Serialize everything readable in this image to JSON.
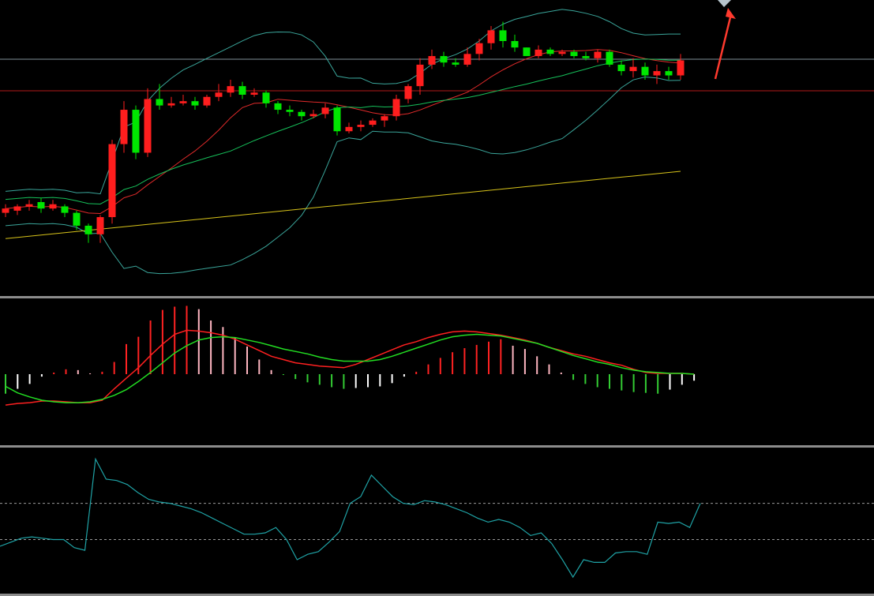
{
  "colors": {
    "background": "#000000",
    "candle_up": "#ff1e1e",
    "candle_down": "#00e600",
    "pane_divider": "#8c8c8c",
    "boll_band": "#3aa59a",
    "ma_mid": "#e02a2a",
    "ma_long": "#16c05a",
    "ma_yellow": "#d6c21a",
    "h_line_gray": "#7f8f99",
    "h_line_red": "#b31a1a",
    "macd_pos": "#ff2222",
    "macd_pos_fade": "#ffb6c1",
    "macd_neg": "#33cc33",
    "macd_neg_fade": "#ffffff",
    "dif_line": "#ff2020",
    "dea_line": "#22dd22",
    "osc_line": "#1fa3a6",
    "osc_level": "#9a9a9a",
    "arrow": "#ff3a2e",
    "marker": "#b7c4cc"
  },
  "chart_data": [
    {
      "type": "candlestick",
      "pane": "price",
      "x_count": 58,
      "ylim": [
        0,
        100
      ],
      "candles": [
        [
          20,
          22,
          18,
          24
        ],
        [
          21,
          23,
          19,
          24
        ],
        [
          23,
          24,
          21,
          26
        ],
        [
          25,
          22,
          20,
          27
        ],
        [
          22,
          24,
          21,
          26
        ],
        [
          23,
          20,
          18,
          24
        ],
        [
          20,
          14,
          12,
          21
        ],
        [
          14,
          10,
          6,
          15
        ],
        [
          10,
          18,
          6,
          19
        ],
        [
          18,
          52,
          15,
          54
        ],
        [
          52,
          68,
          48,
          72
        ],
        [
          68,
          48,
          45,
          70
        ],
        [
          48,
          73,
          46,
          78
        ],
        [
          73,
          70,
          68,
          80
        ],
        [
          70,
          71,
          69,
          74
        ],
        [
          71,
          72,
          70,
          75
        ],
        [
          72,
          70,
          68,
          74
        ],
        [
          70,
          74,
          69,
          75
        ],
        [
          74,
          76,
          72,
          80
        ],
        [
          76,
          79,
          74,
          82
        ],
        [
          79,
          75,
          73,
          81
        ],
        [
          75,
          76,
          74,
          78
        ],
        [
          76,
          71,
          69,
          77
        ],
        [
          71,
          68,
          66,
          72
        ],
        [
          68,
          67,
          65,
          70
        ],
        [
          67,
          65,
          63,
          68
        ],
        [
          65,
          66,
          64,
          68
        ],
        [
          66,
          69,
          64,
          71
        ],
        [
          69,
          58,
          56,
          70
        ],
        [
          58,
          60,
          57,
          62
        ],
        [
          60,
          61,
          58,
          63
        ],
        [
          61,
          63,
          60,
          64
        ],
        [
          63,
          65,
          60,
          66
        ],
        [
          65,
          73,
          63,
          75
        ],
        [
          73,
          79,
          71,
          80
        ],
        [
          79,
          89,
          75,
          92
        ],
        [
          89,
          93,
          87,
          96
        ],
        [
          93,
          90,
          88,
          95
        ],
        [
          90,
          89,
          88,
          92
        ],
        [
          89,
          94,
          88,
          97
        ],
        [
          94,
          99,
          91,
          101
        ],
        [
          99,
          105,
          96,
          107
        ],
        [
          105,
          100,
          97,
          109
        ],
        [
          100,
          97,
          95,
          103
        ],
        [
          97,
          93,
          94,
          97
        ],
        [
          93,
          96,
          92,
          98
        ],
        [
          96,
          94,
          93,
          97
        ],
        [
          94,
          95,
          93,
          96
        ],
        [
          95,
          93,
          92,
          96
        ],
        [
          93,
          92,
          91,
          95
        ],
        [
          92,
          95,
          90,
          96
        ],
        [
          95,
          89,
          88,
          96
        ],
        [
          89,
          86,
          84,
          91
        ],
        [
          86,
          88,
          83,
          92
        ],
        [
          88,
          84,
          82,
          90
        ],
        [
          84,
          86,
          80,
          89
        ],
        [
          86,
          84,
          82,
          88
        ],
        [
          84,
          91,
          82,
          94
        ]
      ]
    },
    {
      "type": "histogram",
      "pane": "macd",
      "values": [
        -2.4,
        -1.8,
        -1.2,
        -0.3,
        0.2,
        0.6,
        0.5,
        0.1,
        0.3,
        1.5,
        3.7,
        4.6,
        6.6,
        7.9,
        8.3,
        8.4,
        8.0,
        6.6,
        5.8,
        4.5,
        3.4,
        1.8,
        0.5,
        -0.1,
        -0.6,
        -1.0,
        -1.3,
        -1.6,
        -1.8,
        -1.7,
        -1.6,
        -1.5,
        -1.1,
        -0.3,
        0.3,
        1.2,
        2.0,
        2.7,
        3.2,
        3.6,
        4.0,
        4.3,
        3.5,
        3.1,
        2.2,
        1.2,
        0.2,
        -0.7,
        -1.2,
        -1.6,
        -1.8,
        -2.0,
        -2.2,
        -2.3,
        -2.4,
        -1.9,
        -1.3,
        -0.8
      ],
      "dif": [
        -3.8,
        -3.6,
        -3.5,
        -3.3,
        -3.3,
        -3.4,
        -3.5,
        -3.5,
        -3.2,
        -1.8,
        -0.5,
        0.8,
        2.3,
        3.7,
        4.9,
        5.4,
        5.3,
        5.1,
        4.8,
        4.3,
        3.6,
        2.9,
        2.2,
        1.8,
        1.4,
        1.2,
        1.0,
        0.9,
        0.8,
        1.2,
        1.8,
        2.4,
        3.0,
        3.6,
        4.0,
        4.5,
        4.9,
        5.2,
        5.3,
        5.2,
        5.0,
        4.8,
        4.5,
        4.2,
        3.8,
        3.3,
        2.9,
        2.5,
        2.2,
        1.8,
        1.4,
        1.1,
        0.6,
        0.2,
        0.1,
        0.1,
        0.1,
        0.0
      ],
      "dea": [
        -1.5,
        -2.3,
        -2.8,
        -3.2,
        -3.4,
        -3.5,
        -3.5,
        -3.4,
        -3.1,
        -2.6,
        -1.9,
        -0.9,
        0.2,
        1.4,
        2.6,
        3.5,
        4.2,
        4.5,
        4.6,
        4.5,
        4.2,
        3.9,
        3.5,
        3.1,
        2.8,
        2.5,
        2.1,
        1.8,
        1.6,
        1.6,
        1.6,
        1.8,
        2.2,
        2.7,
        3.2,
        3.7,
        4.2,
        4.6,
        4.8,
        4.9,
        4.8,
        4.7,
        4.4,
        4.1,
        3.8,
        3.3,
        2.8,
        2.3,
        1.9,
        1.5,
        1.2,
        0.8,
        0.5,
        0.3,
        0.2,
        0.1,
        0.1,
        0.0
      ]
    },
    {
      "type": "line",
      "pane": "oscillator",
      "values": [
        30,
        33,
        36,
        37,
        36,
        35,
        35,
        29,
        27,
        95,
        80,
        79,
        76,
        70,
        65,
        63,
        62,
        60,
        58,
        55,
        51,
        47,
        43,
        39,
        39,
        40,
        44,
        35,
        20,
        24,
        26,
        33,
        41,
        62,
        67,
        83,
        75,
        67,
        62,
        61,
        64,
        63,
        61,
        58,
        55,
        51,
        48,
        50,
        48,
        44,
        38,
        40,
        32,
        20,
        7,
        20,
        18,
        18,
        25,
        26,
        26,
        24,
        48,
        47,
        48,
        44,
        62
      ],
      "levels": [
        62,
        35
      ],
      "ylim": [
        0,
        100
      ]
    }
  ]
}
